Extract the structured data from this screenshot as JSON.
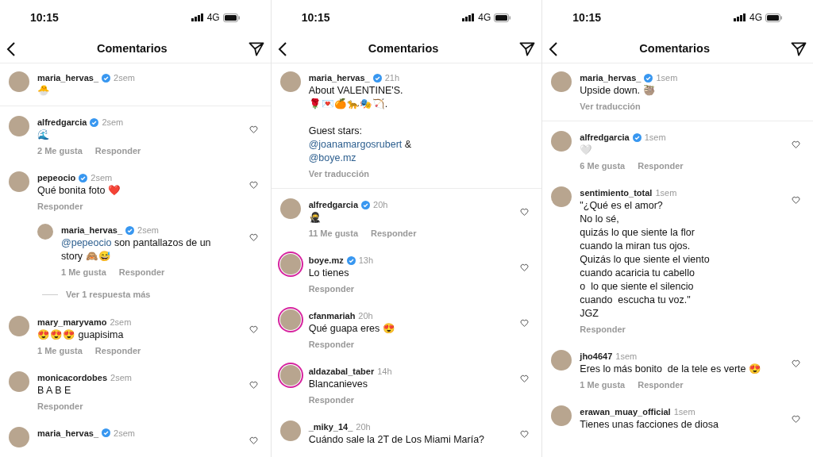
{
  "panels": [
    {
      "status_bar": {
        "time": "10:15",
        "network": "4G"
      },
      "header": {
        "title": "Comentarios"
      },
      "post": {
        "user": "maria_hervas_",
        "verified": true,
        "time": "2sem",
        "paragraphs": [
          [
            [
              {
                "kind": "text",
                "text": "🐣"
              }
            ]
          ]
        ]
      },
      "comments": [
        {
          "user": "alfredgarcia",
          "verified": true,
          "time": "2sem",
          "paragraphs": [
            [
              [
                {
                  "kind": "text",
                  "text": "🌊"
                }
              ]
            ]
          ],
          "likes": "2 Me gusta",
          "reply": "Responder",
          "story_ring": false
        },
        {
          "user": "pepeocio",
          "verified": true,
          "time": "2sem",
          "paragraphs": [
            [
              [
                {
                  "kind": "text",
                  "text": "Qué bonita foto ❤️"
                }
              ]
            ]
          ],
          "reply": "Responder",
          "story_ring": false,
          "children": [
            {
              "user": "maria_hervas_",
              "verified": true,
              "time": "2sem",
              "paragraphs": [
                [
                  [
                    {
                      "kind": "mention",
                      "text": "@pepeocio"
                    },
                    {
                      "kind": "text",
                      "text": " son pantallazos de un"
                    }
                  ],
                  [
                    {
                      "kind": "text",
                      "text": "story 🙈😅"
                    }
                  ]
                ]
              ],
              "likes": "1 Me gusta",
              "reply": "Responder",
              "story_ring": false
            }
          ],
          "more_replies": "Ver 1 respuesta más"
        },
        {
          "user": "mary_maryvamo",
          "verified": false,
          "time": "2sem",
          "paragraphs": [
            [
              [
                {
                  "kind": "text",
                  "text": "😍😍😍 guapisima"
                }
              ]
            ]
          ],
          "likes": "1 Me gusta",
          "reply": "Responder",
          "story_ring": false
        },
        {
          "user": "monicacordobes",
          "verified": false,
          "time": "2sem",
          "paragraphs": [
            [
              [
                {
                  "kind": "text",
                  "text": "B A B E"
                }
              ]
            ]
          ],
          "reply": "Responder",
          "story_ring": false
        },
        {
          "user": "maria_hervas_",
          "verified": true,
          "time": "2sem",
          "story_ring": false
        }
      ]
    },
    {
      "status_bar": {
        "time": "10:15",
        "network": "4G"
      },
      "header": {
        "title": "Comentarios"
      },
      "post": {
        "user": "maria_hervas_",
        "verified": true,
        "time": "21h",
        "paragraphs": [
          [
            [
              {
                "kind": "text",
                "text": "About VALENTINE'S."
              }
            ],
            [
              {
                "kind": "text",
                "text": "🌹💌🍊🐆🎭🏹."
              }
            ]
          ],
          [
            [
              {
                "kind": "text",
                "text": "Guest stars:"
              }
            ],
            [
              {
                "kind": "mention",
                "text": "@joanamargosrubert"
              },
              {
                "kind": "text",
                "text": " &"
              }
            ],
            [
              {
                "kind": "mention",
                "text": "@boye.mz"
              }
            ]
          ]
        ],
        "translate": "Ver traducción"
      },
      "comments": [
        {
          "user": "alfredgarcia",
          "verified": true,
          "time": "20h",
          "paragraphs": [
            [
              [
                {
                  "kind": "text",
                  "text": "🥷"
                }
              ]
            ]
          ],
          "likes": "11 Me gusta",
          "reply": "Responder",
          "story_ring": false
        },
        {
          "user": "boye.mz",
          "verified": true,
          "time": "13h",
          "paragraphs": [
            [
              [
                {
                  "kind": "text",
                  "text": "Lo tienes"
                }
              ]
            ]
          ],
          "reply": "Responder",
          "story_ring": true
        },
        {
          "user": "cfanmariah",
          "verified": false,
          "time": "20h",
          "paragraphs": [
            [
              [
                {
                  "kind": "text",
                  "text": "Qué guapa eres 😍"
                }
              ]
            ]
          ],
          "reply": "Responder",
          "story_ring": true
        },
        {
          "user": "aldazabal_taber",
          "verified": false,
          "time": "14h",
          "paragraphs": [
            [
              [
                {
                  "kind": "text",
                  "text": "Blancanieves"
                }
              ]
            ]
          ],
          "reply": "Responder",
          "story_ring": true
        },
        {
          "user": "_miky_14_",
          "verified": false,
          "time": "20h",
          "paragraphs": [
            [
              [
                {
                  "kind": "text",
                  "text": "Cuándo sale la 2T de Los Miami María?"
                }
              ]
            ]
          ],
          "story_ring": false
        }
      ]
    },
    {
      "status_bar": {
        "time": "10:15",
        "network": "4G"
      },
      "header": {
        "title": "Comentarios"
      },
      "post": {
        "user": "maria_hervas_",
        "verified": true,
        "time": "1sem",
        "paragraphs": [
          [
            [
              {
                "kind": "text",
                "text": "Upside down. 🦥"
              }
            ]
          ]
        ],
        "translate": "Ver traducción"
      },
      "comments": [
        {
          "user": "alfredgarcia",
          "verified": true,
          "time": "1sem",
          "paragraphs": [
            [
              [
                {
                  "kind": "text",
                  "text": "🤍"
                }
              ]
            ]
          ],
          "likes": "6 Me gusta",
          "reply": "Responder",
          "story_ring": false
        },
        {
          "user": "sentimiento_total",
          "verified": false,
          "time": "1sem",
          "paragraphs": [
            [
              [
                {
                  "kind": "text",
                  "text": "\"¿Qué es el amor?"
                }
              ],
              [
                {
                  "kind": "text",
                  "text": "No lo sé,"
                }
              ],
              [
                {
                  "kind": "text",
                  "text": "quizás lo que siente la flor"
                }
              ],
              [
                {
                  "kind": "text",
                  "text": "cuando la miran tus ojos."
                }
              ],
              [
                {
                  "kind": "text",
                  "text": "Quizás lo que siente el viento"
                }
              ],
              [
                {
                  "kind": "text",
                  "text": "cuando acaricia tu cabello"
                }
              ],
              [
                {
                  "kind": "text",
                  "text": "o  lo que siente el silencio"
                }
              ],
              [
                {
                  "kind": "text",
                  "text": "cuando  escucha tu voz.\""
                }
              ],
              [
                {
                  "kind": "text",
                  "text": "JGZ"
                }
              ]
            ]
          ],
          "reply": "Responder",
          "story_ring": false
        },
        {
          "user": "jho4647",
          "verified": false,
          "time": "1sem",
          "paragraphs": [
            [
              [
                {
                  "kind": "text",
                  "text": "Eres lo más bonito  de la tele es verte 😍"
                }
              ]
            ]
          ],
          "likes": "1 Me gusta",
          "reply": "Responder",
          "story_ring": false
        },
        {
          "user": "erawan_muay_official",
          "verified": false,
          "time": "1sem",
          "paragraphs": [
            [
              [
                {
                  "kind": "text",
                  "text": "Tienes unas facciones de diosa"
                }
              ]
            ]
          ],
          "story_ring": false
        }
      ]
    }
  ]
}
